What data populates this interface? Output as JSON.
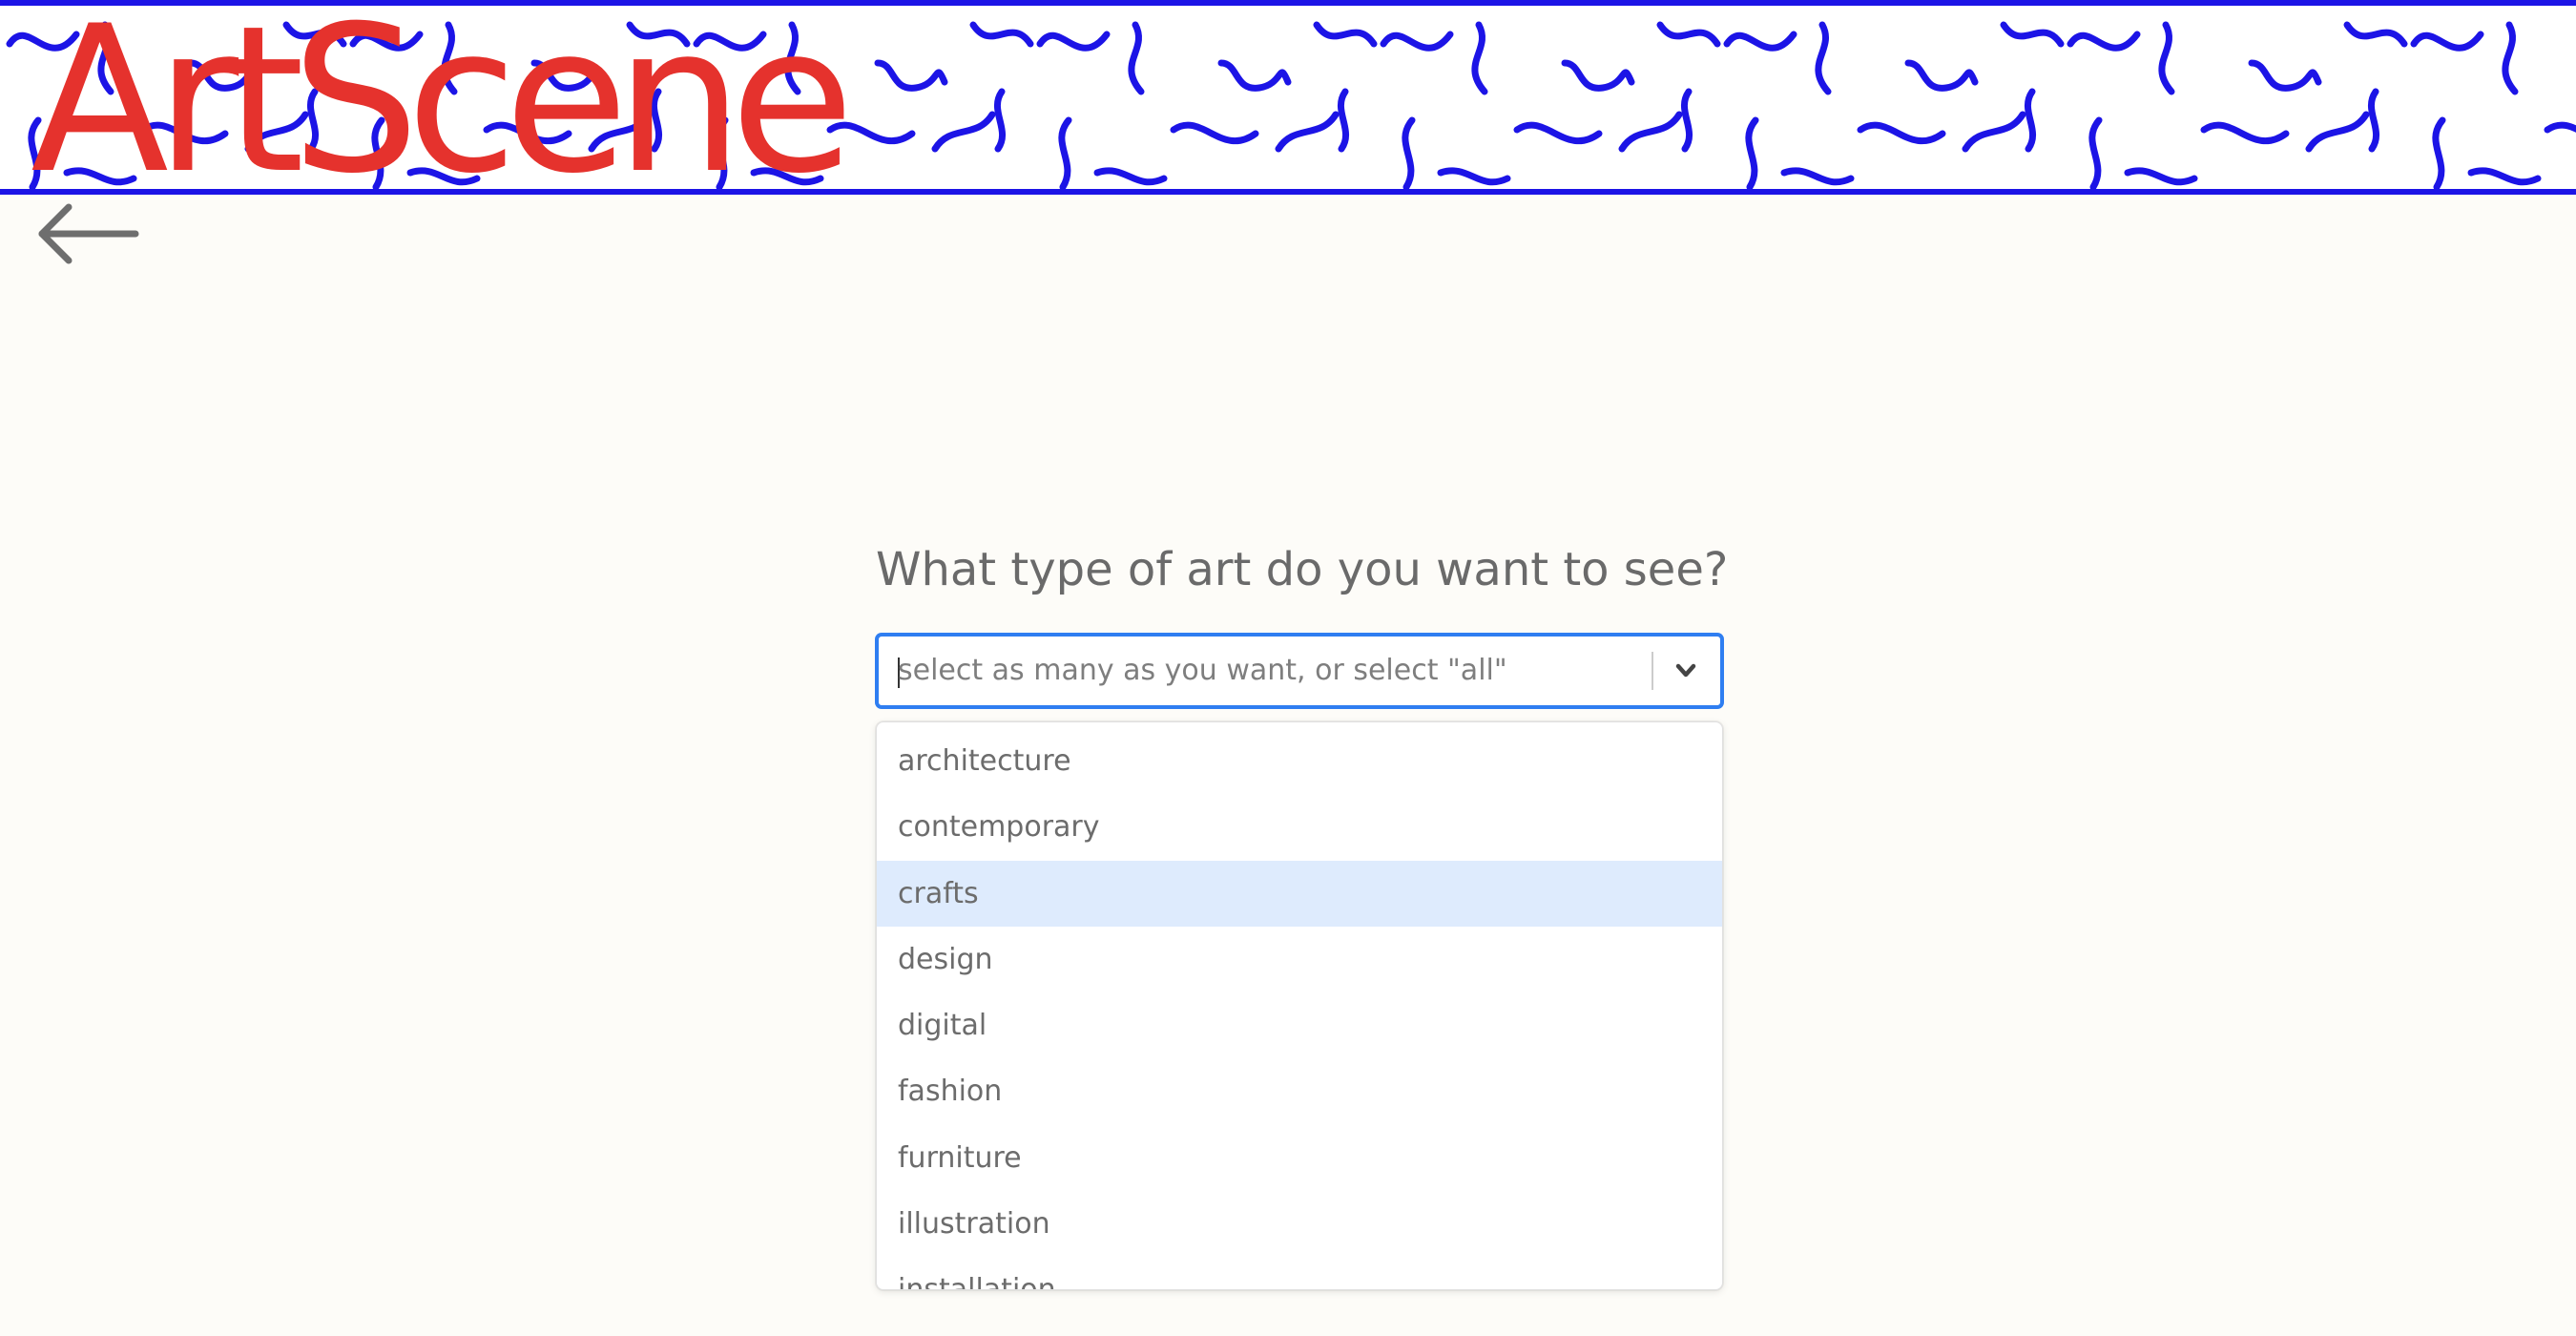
{
  "app": {
    "logo_text": "ArtScene",
    "brand_color": "#e5322d",
    "banner_accent": "#1c14e6"
  },
  "nav": {
    "back_icon": "arrow-left-icon"
  },
  "form": {
    "question": "What type of art do you want to see?",
    "select": {
      "placeholder": "select as many as you want, or select \"all\"",
      "dropdown_icon": "chevron-down-icon",
      "focus_color": "#2f7ef1",
      "highlight_color": "#deebfd",
      "options": [
        {
          "label": "architecture"
        },
        {
          "label": "contemporary"
        },
        {
          "label": "crafts",
          "focused": true
        },
        {
          "label": "design"
        },
        {
          "label": "digital"
        },
        {
          "label": "fashion"
        },
        {
          "label": "furniture"
        },
        {
          "label": "illustration"
        },
        {
          "label": "installation"
        }
      ]
    }
  }
}
